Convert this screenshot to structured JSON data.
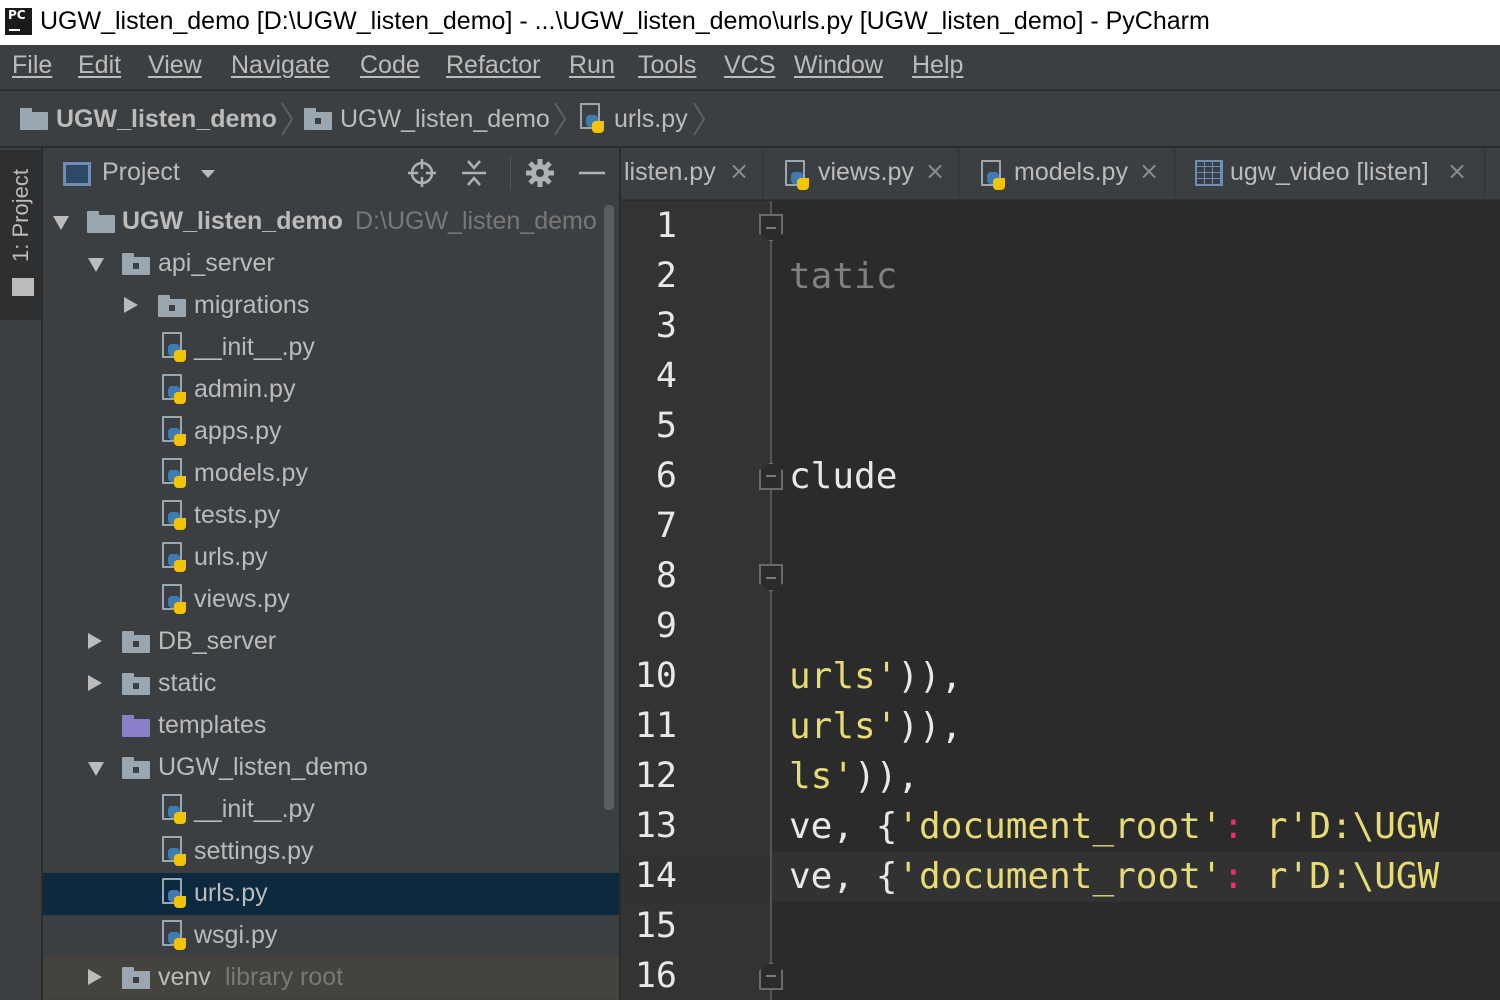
{
  "window": {
    "title": "UGW_listen_demo [D:\\UGW_listen_demo] - ...\\UGW_listen_demo\\urls.py [UGW_listen_demo] - PyCharm",
    "app_icon_text": "PC"
  },
  "menu": [
    "File",
    "Edit",
    "View",
    "Navigate",
    "Code",
    "Refactor",
    "Run",
    "Tools",
    "VCS",
    "Window",
    "Help"
  ],
  "breadcrumb": [
    "UGW_listen_demo",
    "UGW_listen_demo",
    "urls.py"
  ],
  "tool_window_stripe": {
    "label": "1: Project"
  },
  "project_panel": {
    "title": "Project",
    "tree": [
      {
        "label": "UGW_listen_demo",
        "hint": "D:\\UGW_listen_demo",
        "type": "folder",
        "state": "open",
        "depth": 0,
        "bold": true
      },
      {
        "label": "api_server",
        "type": "folder",
        "state": "open",
        "depth": 1
      },
      {
        "label": "migrations",
        "type": "folder",
        "state": "closed",
        "depth": 2
      },
      {
        "label": "__init__.py",
        "type": "py",
        "depth": 2
      },
      {
        "label": "admin.py",
        "type": "py",
        "depth": 2
      },
      {
        "label": "apps.py",
        "type": "py",
        "depth": 2
      },
      {
        "label": "models.py",
        "type": "py",
        "depth": 2
      },
      {
        "label": "tests.py",
        "type": "py",
        "depth": 2
      },
      {
        "label": "urls.py",
        "type": "py",
        "depth": 2
      },
      {
        "label": "views.py",
        "type": "py",
        "depth": 2
      },
      {
        "label": "DB_server",
        "type": "folder",
        "state": "closed",
        "depth": 1
      },
      {
        "label": "static",
        "type": "folder",
        "state": "closed",
        "depth": 1
      },
      {
        "label": "templates",
        "type": "folder-purple",
        "depth": 1
      },
      {
        "label": "UGW_listen_demo",
        "type": "folder",
        "state": "open",
        "depth": 1
      },
      {
        "label": "__init__.py",
        "type": "py",
        "depth": 2
      },
      {
        "label": "settings.py",
        "type": "py",
        "depth": 2
      },
      {
        "label": "urls.py",
        "type": "py",
        "depth": 2,
        "selected": true
      },
      {
        "label": "wsgi.py",
        "type": "py",
        "depth": 2
      },
      {
        "label": "venv",
        "hint": "library root",
        "type": "folder",
        "state": "closed",
        "depth": 1,
        "dim": true
      }
    ]
  },
  "tabs": [
    {
      "label": "listen.py",
      "icon": "none"
    },
    {
      "label": "views.py",
      "icon": "py"
    },
    {
      "label": "models.py",
      "icon": "py"
    },
    {
      "label": "ugw_video [listen]",
      "icon": "table"
    }
  ],
  "editor": {
    "current_line": 14,
    "lines": [
      {
        "n": "1",
        "tokens": []
      },
      {
        "n": "2",
        "tokens": [
          {
            "t": "tatic",
            "c": "gray"
          }
        ]
      },
      {
        "n": "3",
        "tokens": []
      },
      {
        "n": "4",
        "tokens": []
      },
      {
        "n": "5",
        "tokens": []
      },
      {
        "n": "6",
        "tokens": [
          {
            "t": "clude",
            "c": "white"
          }
        ]
      },
      {
        "n": "7",
        "tokens": []
      },
      {
        "n": "8",
        "tokens": []
      },
      {
        "n": "9",
        "tokens": []
      },
      {
        "n": "10",
        "tokens": [
          {
            "t": "urls'",
            "c": "str"
          },
          {
            "t": ")),",
            "c": "white"
          }
        ]
      },
      {
        "n": "11",
        "tokens": [
          {
            "t": "urls'",
            "c": "str"
          },
          {
            "t": ")),",
            "c": "white"
          }
        ]
      },
      {
        "n": "12",
        "tokens": [
          {
            "t": "ls'",
            "c": "str"
          },
          {
            "t": ")),",
            "c": "white"
          }
        ]
      },
      {
        "n": "13",
        "tokens": [
          {
            "t": "ve, {",
            "c": "white"
          },
          {
            "t": "'document_root'",
            "c": "str"
          },
          {
            "t": ": ",
            "c": "colon"
          },
          {
            "t": "r'D:\\UGW",
            "c": "str"
          }
        ]
      },
      {
        "n": "14",
        "tokens": [
          {
            "t": "ve, {",
            "c": "white"
          },
          {
            "t": "'document_root'",
            "c": "str"
          },
          {
            "t": ": ",
            "c": "colon"
          },
          {
            "t": "r'D:\\UGW",
            "c": "str"
          }
        ]
      },
      {
        "n": "15",
        "tokens": []
      },
      {
        "n": "16",
        "tokens": []
      }
    ]
  },
  "colors": {
    "panel_bg": "#3c3f41",
    "editor_bg": "#2b2b2b",
    "selection": "#0d293e",
    "string": "#e6db74",
    "keyword_colon": "#f92672"
  }
}
